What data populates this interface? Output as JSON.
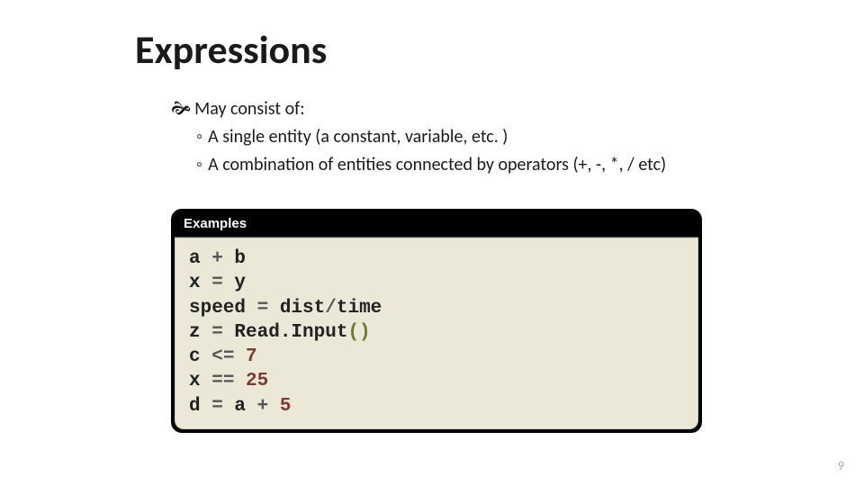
{
  "title": "Expressions",
  "intro": "May consist of:",
  "bullets": [
    "A single entity (a constant, variable, etc. )",
    "A combination of entities connected by operators (+, -, *, / etc)"
  ],
  "examples_label": "Examples",
  "code": [
    [
      {
        "t": "a",
        "c": "id"
      },
      {
        "t": " + ",
        "c": "op"
      },
      {
        "t": "b",
        "c": "id"
      }
    ],
    [
      {
        "t": "x",
        "c": "id"
      },
      {
        "t": " = ",
        "c": "op"
      },
      {
        "t": "y",
        "c": "id"
      }
    ],
    [
      {
        "t": "speed",
        "c": "id"
      },
      {
        "t": " = ",
        "c": "op"
      },
      {
        "t": "dist",
        "c": "id"
      },
      {
        "t": "/",
        "c": "op"
      },
      {
        "t": "time",
        "c": "id"
      }
    ],
    [
      {
        "t": "z",
        "c": "id"
      },
      {
        "t": " = ",
        "c": "op"
      },
      {
        "t": "Read.Input",
        "c": "id"
      },
      {
        "t": "()",
        "c": "par"
      }
    ],
    [
      {
        "t": "c",
        "c": "id"
      },
      {
        "t": " <= ",
        "c": "op"
      },
      {
        "t": "7",
        "c": "num"
      }
    ],
    [
      {
        "t": "x",
        "c": "id"
      },
      {
        "t": " == ",
        "c": "op"
      },
      {
        "t": "25",
        "c": "num"
      }
    ],
    [
      {
        "t": "d",
        "c": "id"
      },
      {
        "t": " = ",
        "c": "op"
      },
      {
        "t": "a",
        "c": "id"
      },
      {
        "t": " + ",
        "c": "op"
      },
      {
        "t": "5",
        "c": "num"
      }
    ]
  ],
  "page_number": "9"
}
